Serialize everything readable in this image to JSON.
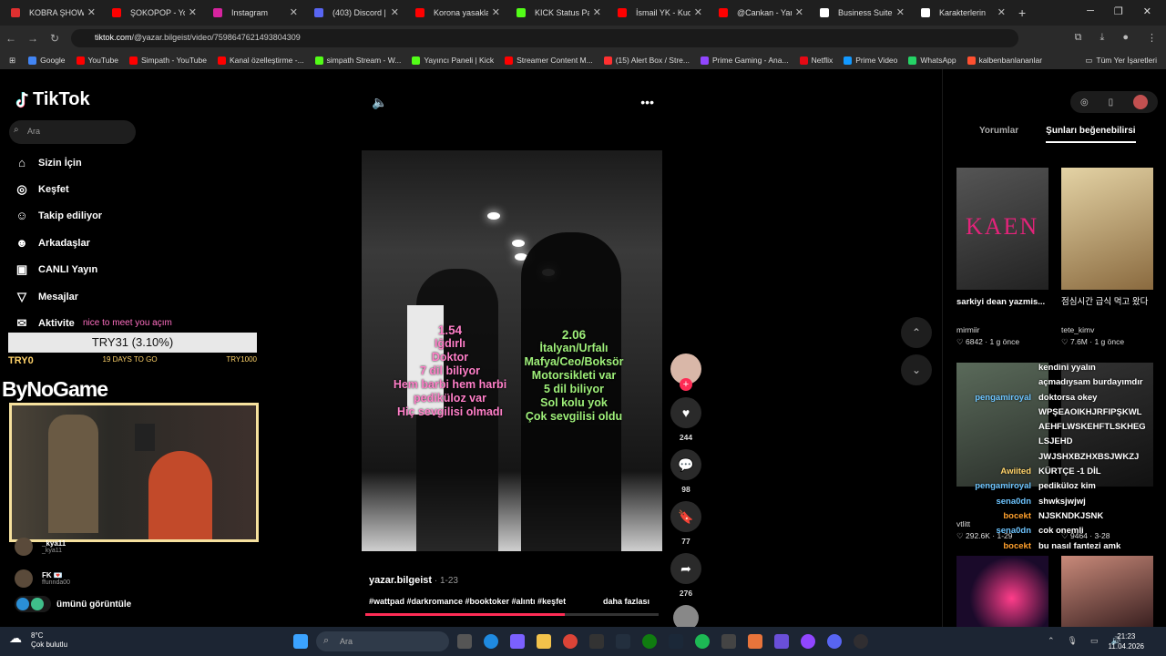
{
  "browser": {
    "tabs": [
      {
        "label": "KOBRA ŞHOW KR",
        "color": "#e03030"
      },
      {
        "label": "ŞOKOPOP - YouTu",
        "color": "#ff0000"
      },
      {
        "label": "Instagram",
        "color": "#d6249f"
      },
      {
        "label": "(403) Discord | #",
        "color": "#5865f2"
      },
      {
        "label": "Korona yasaklann",
        "color": "#ff0000"
      },
      {
        "label": "KICK Status Page",
        "color": "#53fc18"
      },
      {
        "label": "İsmail YK - Kudur",
        "color": "#ff0000"
      },
      {
        "label": "@Cankan - Yaran",
        "color": "#ff0000"
      },
      {
        "label": "Business Suite | Ti",
        "color": "#ffffff"
      },
      {
        "label": "Karakterlerin",
        "color": "#ffffff"
      }
    ],
    "url_domain": "tiktok.com",
    "url_path": "/@yazar.bilgeist/video/7598647621493804309",
    "bookmarks": [
      {
        "label": "Google",
        "color": "#4285f4"
      },
      {
        "label": "YouTube",
        "color": "#ff0000"
      },
      {
        "label": "Simpath - YouTube",
        "color": "#ff0000"
      },
      {
        "label": "Kanal özelleştirme -...",
        "color": "#ff0000"
      },
      {
        "label": "simpath Stream - W...",
        "color": "#53fc18"
      },
      {
        "label": "Yayıncı Paneli | Kick",
        "color": "#53fc18"
      },
      {
        "label": "Streamer Content M...",
        "color": "#ff0000"
      },
      {
        "label": "(15) Alert Box / Stre...",
        "color": "#ff3030"
      },
      {
        "label": "Prime Gaming - Ana...",
        "color": "#9146ff"
      },
      {
        "label": "Netflix",
        "color": "#e50914"
      },
      {
        "label": "Prime Video",
        "color": "#1399ff"
      },
      {
        "label": "WhatsApp",
        "color": "#25d366"
      },
      {
        "label": "kalbenbanlananlar",
        "color": "#ff5030"
      }
    ],
    "all_bookmarks": "Tüm Yer İşaretleri"
  },
  "sidebar": {
    "logo": "TikTok",
    "search_placeholder": "Ara",
    "items": [
      {
        "label": "Sizin İçin",
        "icon": "⌂"
      },
      {
        "label": "Keşfet",
        "icon": "◎"
      },
      {
        "label": "Takip ediliyor",
        "icon": "☺"
      },
      {
        "label": "Arkadaşlar",
        "icon": "☻"
      },
      {
        "label": "CANLI Yayın",
        "icon": "▣"
      },
      {
        "label": "Mesajlar",
        "icon": "▽"
      },
      {
        "label": "Aktivite",
        "icon": "✉"
      }
    ],
    "show_all": "ümünü görüntüle",
    "followers": [
      {
        "name": "_kya11",
        "sub": "_kya11"
      },
      {
        "name": "FK 💌",
        "sub": "ffunnda00"
      }
    ]
  },
  "overlay": {
    "chat_line": "nice to meet you açım",
    "goal_text": "TRY31 (3.10%)",
    "goal_percent": 3.1,
    "goal_left": "TRY0",
    "goal_mid": "19 DAYS TO GO",
    "goal_right": "TRY1000",
    "brand": "ByNoGame"
  },
  "video": {
    "pink_text": [
      "1.54",
      "Iğdırlı",
      "Doktor",
      "7 dil biliyor",
      "Hem barbi hem harbi",
      "pediküloz var",
      "Hiç sevgilisi olmadı"
    ],
    "green_text": [
      "2.06",
      "İtalyan/Urfalı",
      "Mafya/Ceo/Boksör",
      "Motorsikleti var",
      "5 dil biliyor",
      "Sol kolu yok",
      "Çok sevgilisi oldu"
    ],
    "author": "yazar.bilgeist",
    "date": " · 1-23",
    "tags": "#wattpad #darkromance #booktoker #alıntı #keşfet",
    "more": "daha fazlası",
    "likes": "244",
    "comments": "98",
    "saves": "77",
    "shares": "276",
    "progress_percent": 68
  },
  "right_panel": {
    "tab_comments": "Yorumlar",
    "tab_similar": "Şunları beğenebilirsi",
    "thumbs": [
      {
        "title": "sarkiyi dean yazmis...",
        "user": "mirmiir",
        "likes": "6842",
        "age": "1 g önce",
        "overlay": "KAEN"
      },
      {
        "title": "점심시간 급식 먹고 왔다",
        "user": "tete_kimv",
        "likes": "7.6M",
        "age": "1 g önce"
      }
    ],
    "row2_meta_left_user": "vtlitt",
    "row2_meta_left": "292.6K · 1-29",
    "row2_meta_right": "9464 · 3-28"
  },
  "chat_overlay": [
    {
      "user": "",
      "msg": "kendini yyalın",
      "c": "u"
    },
    {
      "user": "",
      "msg": "açmadıysam burdayımdır",
      "c": "u"
    },
    {
      "user": "pengamiroyal",
      "msg": "doktorsa okey",
      "c": "u"
    },
    {
      "user": "",
      "msg": "WPŞEAOIKHJRFIPŞKWL",
      "c": "u"
    },
    {
      "user": "",
      "msg": "AEHFLWSKEHFTLSKHEG",
      "c": "u"
    },
    {
      "user": "",
      "msg": "LSJEHD",
      "c": "u"
    },
    {
      "user": "",
      "msg": "JWJSHXBZHXBSJWKZJ",
      "c": "u"
    },
    {
      "user": "Awiited",
      "msg": "KÜRTÇE -1 DİL",
      "c": "y"
    },
    {
      "user": "pengamiroyal",
      "msg": "pediküloz kim",
      "c": "u"
    },
    {
      "user": "sena0dn",
      "msg": "shwksjwjwj",
      "c": "u"
    },
    {
      "user": "bocekt",
      "msg": "NJSKNDKJSNK",
      "c": "o"
    },
    {
      "user": "sena0dn",
      "msg": "cok onemli",
      "c": "u"
    },
    {
      "user": "bocekt",
      "msg": "bu nasıl fantezi amk",
      "c": "o"
    }
  ],
  "taskbar": {
    "temp": "8°C",
    "weather": "Çok bulutlu",
    "search": "Ara",
    "time": "21:23",
    "date": "11.04.2026"
  }
}
